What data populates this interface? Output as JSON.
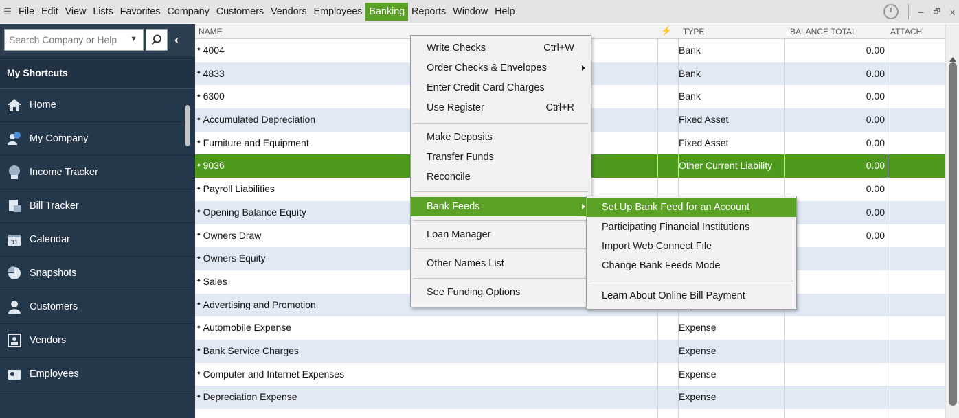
{
  "menubar": {
    "items": [
      {
        "label": "File"
      },
      {
        "label": "Edit"
      },
      {
        "label": "View"
      },
      {
        "label": "Lists"
      },
      {
        "label": "Favorites"
      },
      {
        "label": "Company"
      },
      {
        "label": "Customers"
      },
      {
        "label": "Vendors"
      },
      {
        "label": "Employees"
      },
      {
        "label": "Banking"
      },
      {
        "label": "Reports"
      },
      {
        "label": "Window"
      },
      {
        "label": "Help"
      }
    ],
    "active": "Banking",
    "minimize": "‒",
    "restore": "🗗",
    "close": "x"
  },
  "sidebar": {
    "search_placeholder": "Search Company or Help",
    "shortcuts_title": "My Shortcuts",
    "items": [
      {
        "label": "Home",
        "icon": "home-icon"
      },
      {
        "label": "My Company",
        "icon": "company-icon"
      },
      {
        "label": "Income Tracker",
        "icon": "income-tracker-icon"
      },
      {
        "label": "Bill Tracker",
        "icon": "bill-tracker-icon"
      },
      {
        "label": "Calendar",
        "icon": "calendar-icon"
      },
      {
        "label": "Snapshots",
        "icon": "snapshots-icon"
      },
      {
        "label": "Customers",
        "icon": "customers-icon"
      },
      {
        "label": "Vendors",
        "icon": "vendors-icon"
      },
      {
        "label": "Employees",
        "icon": "employees-icon"
      }
    ]
  },
  "table": {
    "columns": {
      "name": "NAME",
      "online": "⚡",
      "type": "TYPE",
      "balance": "BALANCE TOTAL",
      "attach": "ATTACH"
    },
    "rows": [
      {
        "name": "4004",
        "type": "Bank",
        "balance": "0.00"
      },
      {
        "name": "4833",
        "type": "Bank",
        "balance": "0.00"
      },
      {
        "name": "6300",
        "type": "Bank",
        "balance": "0.00"
      },
      {
        "name": "Accumulated Depreciation",
        "type": "Fixed Asset",
        "balance": "0.00"
      },
      {
        "name": "Furniture and Equipment",
        "type": "Fixed Asset",
        "balance": "0.00"
      },
      {
        "name": "9036",
        "type": "Other Current Liability",
        "balance": "0.00"
      },
      {
        "name": "Payroll Liabilities",
        "type": "",
        "balance": "0.00"
      },
      {
        "name": "Opening Balance Equity",
        "type": "",
        "balance": "0.00"
      },
      {
        "name": "Owners Draw",
        "type": "",
        "balance": "0.00"
      },
      {
        "name": "Owners Equity",
        "type": "",
        "balance": ""
      },
      {
        "name": "Sales",
        "type": "",
        "balance": ""
      },
      {
        "name": "Advertising and Promotion",
        "type": "Expense",
        "balance": ""
      },
      {
        "name": "Automobile Expense",
        "type": "Expense",
        "balance": ""
      },
      {
        "name": "Bank Service Charges",
        "type": "Expense",
        "balance": ""
      },
      {
        "name": "Computer and Internet Expenses",
        "type": "Expense",
        "balance": ""
      },
      {
        "name": "Depreciation Expense",
        "type": "Expense",
        "balance": ""
      }
    ],
    "selected_index": 5
  },
  "banking_menu": {
    "write_checks": "Write Checks",
    "write_checks_shortcut": "Ctrl+W",
    "order_checks": "Order Checks & Envelopes",
    "enter_cc": "Enter Credit Card Charges",
    "use_register": "Use Register",
    "use_register_shortcut": "Ctrl+R",
    "make_deposits": "Make Deposits",
    "transfer_funds": "Transfer Funds",
    "reconcile": "Reconcile",
    "bank_feeds": "Bank Feeds",
    "loan_manager": "Loan Manager",
    "other_names": "Other Names List",
    "funding": "See Funding Options"
  },
  "bank_feeds_menu": {
    "setup": "Set Up Bank Feed for an Account",
    "participating": "Participating Financial Institutions",
    "import": "Import Web Connect File",
    "change_mode": "Change Bank Feeds Mode",
    "learn": "Learn About Online Bill Payment"
  },
  "colors": {
    "accent": "#5aa126",
    "sidebar": "#25374a",
    "row_alt": "#e1e9f5"
  }
}
